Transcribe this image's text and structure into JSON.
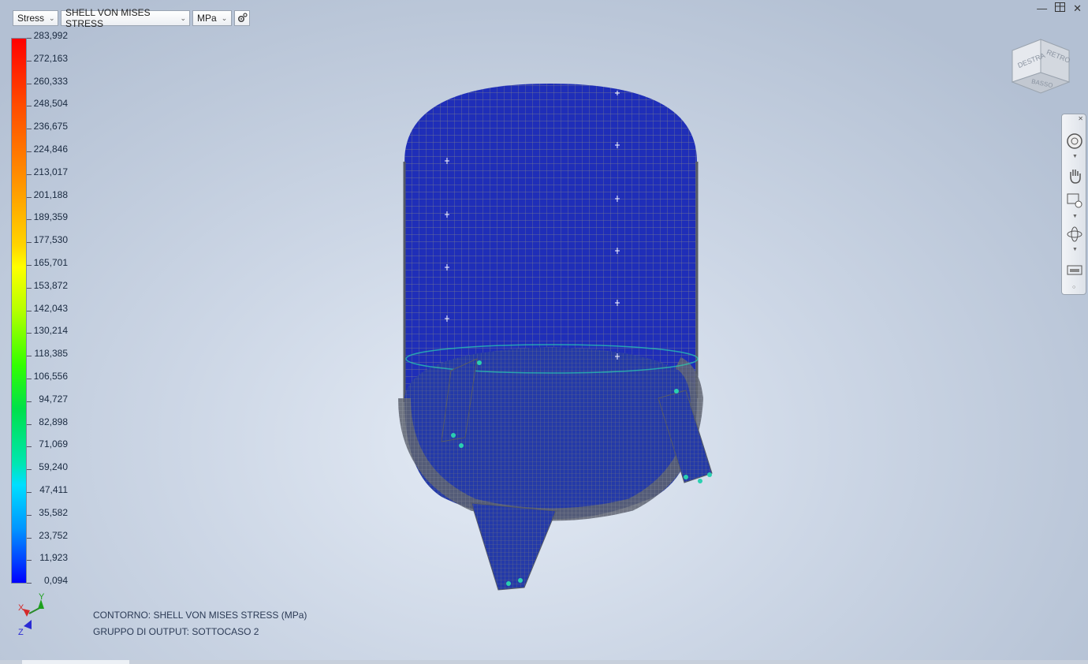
{
  "toolbar": {
    "result_type": "Stress",
    "component": "SHELL VON MISES STRESS",
    "units": "MPa"
  },
  "legend": {
    "values": [
      "283,992",
      "272,163",
      "260,333",
      "248,504",
      "236,675",
      "224,846",
      "213,017",
      "201,188",
      "189,359",
      "177,530",
      "165,701",
      "153,872",
      "142,043",
      "130,214",
      "118,385",
      "106,556",
      "94,727",
      "82,898",
      "71,069",
      "59,240",
      "47,411",
      "35,582",
      "23,752",
      "11,923",
      "0,094"
    ],
    "colors": {
      "max": "#ff0000",
      "mid": "#ffff00",
      "low": "#00e6b0",
      "min": "#0000ff"
    }
  },
  "captions": {
    "contour": "CONTORNO: SHELL VON MISES STRESS (MPa)",
    "output_group": "GRUPPO DI OUTPUT: SOTTOCASO 2"
  },
  "axis": {
    "x": "X",
    "y": "Y",
    "z": "Z"
  },
  "viewcube": {
    "face_left": "DESTRA",
    "face_right": "RETRO",
    "face_bottom": "BASSO"
  },
  "icons": {
    "gear": "gear-icon",
    "minimize": "minimize-icon",
    "restore": "restore-icon",
    "close": "close-icon",
    "nav": [
      "steering-wheel-icon",
      "pan-hand-icon",
      "zoom-window-icon",
      "orbit-icon",
      "look-at-icon"
    ]
  },
  "model": {
    "description_colors": {
      "shell": "#1e2fb0",
      "mesh": "#6a6f7a",
      "support": "#2ad0b0"
    }
  }
}
